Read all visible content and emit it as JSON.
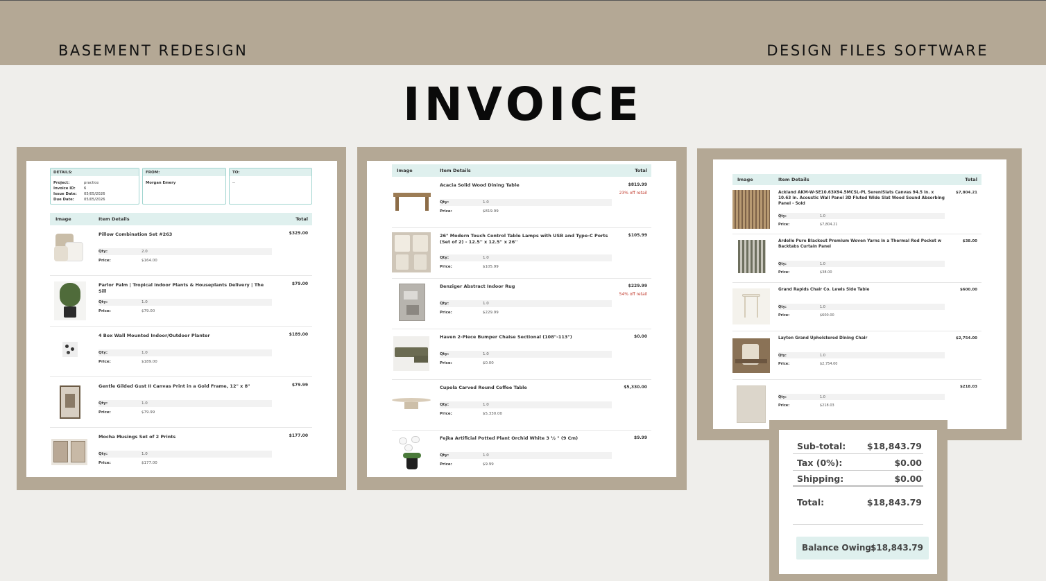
{
  "header": {
    "left_title": "BASEMENT REDESIGN",
    "right_title": "DESIGN FILES SOFTWARE"
  },
  "main_title": "INVOICE",
  "details": {
    "details_header": "DETAILS:",
    "from_header": "FROM:",
    "to_header": "TO:",
    "project_label": "Project:",
    "project_value": "practice",
    "invoice_label": "Invoice ID:",
    "invoice_value": "6",
    "issue_label": "Issue Date:",
    "issue_value": "05/05/2026",
    "due_label": "Due Date:",
    "due_value": "05/05/2026",
    "from_value": "Morgan Emery",
    "to_value": "--"
  },
  "table_headers": {
    "image": "Image",
    "details": "Item Details",
    "total": "Total"
  },
  "labels": {
    "qty": "Qty:",
    "price": "Price:"
  },
  "page1_items": [
    {
      "name": "Pillow Combination Set #263",
      "total": "$329.00",
      "qty": "2.0",
      "price": "$164.00"
    },
    {
      "name": "Parlor Palm | Tropical Indoor Plants & Houseplants Delivery | The Sill",
      "total": "$79.00",
      "qty": "1.0",
      "price": "$79.00"
    },
    {
      "name": "4 Box Wall Mounted Indoor/Outdoor Planter",
      "total": "$189.00",
      "qty": "1.0",
      "price": "$189.00"
    },
    {
      "name": "Gentle Gilded Gust II Canvas Print in a Gold Frame, 12\" x 8\"",
      "total": "$79.99",
      "qty": "1.0",
      "price": "$79.99"
    },
    {
      "name": "Mocha Musings Set of 2 Prints",
      "total": "$177.00",
      "qty": "1.0",
      "price": "$177.00"
    }
  ],
  "page2_items": [
    {
      "name": "Acacia Solid Wood Dining Table",
      "total": "$819.99",
      "discount": "23% off retail",
      "qty": "1.0",
      "price": "$819.99"
    },
    {
      "name": "26\" Modern Touch Control Table Lamps with USB and Type-C Ports (Set of 2) - 12.5'' x 12.5'' x 26''",
      "total": "$105.99",
      "discount": "",
      "qty": "1.0",
      "price": "$105.99"
    },
    {
      "name": "Benziger Abstract Indoor Rug",
      "total": "$229.99",
      "discount": "54% off retail",
      "qty": "1.0",
      "price": "$229.99"
    },
    {
      "name": "Haven 2-Piece Bumper Chaise Sectional (108\"-113\")",
      "total": "$0.00",
      "discount": "",
      "qty": "1.0",
      "price": "$0.00"
    },
    {
      "name": "Cupola Carved Round Coffee Table",
      "total": "$5,330.00",
      "discount": "",
      "qty": "1.0",
      "price": "$5,330.00"
    },
    {
      "name": "Fejka Artificial Potted Plant Orchid White 3 ½ \" (9 Cm)",
      "total": "$9.99",
      "discount": "",
      "qty": "1.0",
      "price": "$9.99"
    }
  ],
  "page3_items": [
    {
      "name": "Ackland AKM-W-SE10.63X94.5MCSL-PL SereniSlats Canvas 94.5 in. x 10.63 in. Acoustic Wall Panel 3D Fluted Wide Slat Wood Sound Absorbing Panel - Sold",
      "total": "$7,804.21",
      "qty": "1.0",
      "price": "$7,804.21"
    },
    {
      "name": "Ardelle Pure Blackout Premium Woven Yarns in a Thermal Rod Pocket w Backtabs Curtain Panel",
      "total": "$38.00",
      "qty": "1.0",
      "price": "$38.00"
    },
    {
      "name": "Grand Rapids Chair Co. Lewis Side Table",
      "total": "$600.00",
      "qty": "1.0",
      "price": "$600.00"
    },
    {
      "name": "Layton Grand Upholstered Dining Chair",
      "total": "$2,754.00",
      "qty": "1.0",
      "price": "$2,754.00"
    },
    {
      "name": "",
      "total": "$218.03",
      "qty": "1.0",
      "price": "$218.03"
    }
  ],
  "totals": {
    "subtotal_label": "Sub-total:",
    "subtotal_value": "$18,843.79",
    "tax_label": "Tax (0%):",
    "tax_value": "$0.00",
    "shipping_label": "Shipping:",
    "shipping_value": "$0.00",
    "total_label": "Total:",
    "total_value": "$18,843.79",
    "balance_label": "Balance Owing:",
    "balance_value": "$18,843.79"
  },
  "colors": {
    "frame": "#b4a895",
    "background": "#efeeeb",
    "table_header": "#dff0ee",
    "discount": "#c0392b"
  }
}
